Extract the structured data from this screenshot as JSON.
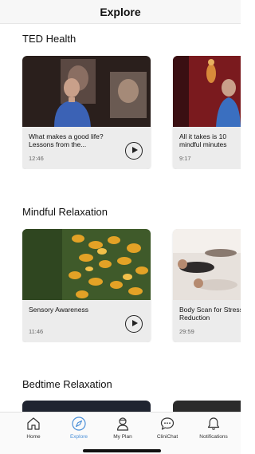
{
  "header": {
    "title": "Explore"
  },
  "sections": [
    {
      "title": "TED Health",
      "cards": [
        {
          "title": "What makes a good life? Lessons from the...",
          "duration": "12:46"
        },
        {
          "title": "All it takes is 10 mindful minutes",
          "duration": "9:17"
        }
      ]
    },
    {
      "title": "Mindful Relaxation",
      "cards": [
        {
          "title": "Sensory Awareness",
          "duration": "11:46"
        },
        {
          "title": "Body Scan for Stress Reduction",
          "duration": "29:59"
        }
      ]
    },
    {
      "title": "Bedtime Relaxation",
      "cards": []
    }
  ],
  "tabbar": {
    "items": [
      {
        "label": "Home",
        "icon": "home-icon"
      },
      {
        "label": "Explore",
        "icon": "compass-icon",
        "active": true
      },
      {
        "label": "My Plan",
        "icon": "person-icon"
      },
      {
        "label": "CliniChat",
        "icon": "chat-bubble-icon"
      },
      {
        "label": "Notifications",
        "icon": "bell-icon"
      }
    ]
  },
  "colors": {
    "accent": "#4a8fd8",
    "card_bg": "#ececec",
    "header_bg": "#f7f7f7"
  }
}
